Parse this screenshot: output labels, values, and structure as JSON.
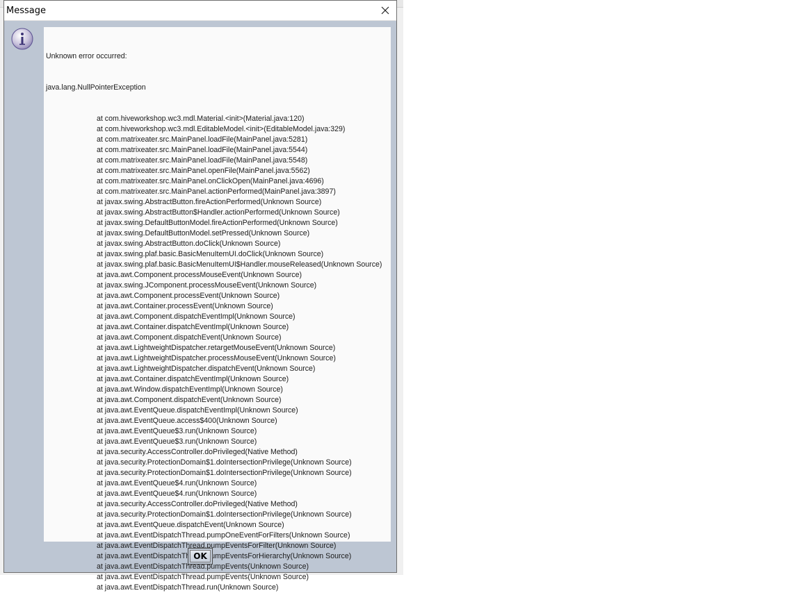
{
  "dialog": {
    "title": "Message",
    "icon": "info-icon",
    "ok_label": "OK"
  },
  "message": {
    "heading": "Unknown error occurred:",
    "exception": "java.lang.NullPointerException",
    "frames": [
      "at com.hiveworkshop.wc3.mdl.Material.<init>(Material.java:120)",
      "at com.hiveworkshop.wc3.mdl.EditableModel.<init>(EditableModel.java:329)",
      "at com.matrixeater.src.MainPanel.loadFile(MainPanel.java:5281)",
      "at com.matrixeater.src.MainPanel.loadFile(MainPanel.java:5544)",
      "at com.matrixeater.src.MainPanel.loadFile(MainPanel.java:5548)",
      "at com.matrixeater.src.MainPanel.openFile(MainPanel.java:5562)",
      "at com.matrixeater.src.MainPanel.onClickOpen(MainPanel.java:4696)",
      "at com.matrixeater.src.MainPanel.actionPerformed(MainPanel.java:3897)",
      "at javax.swing.AbstractButton.fireActionPerformed(Unknown Source)",
      "at javax.swing.AbstractButton$Handler.actionPerformed(Unknown Source)",
      "at javax.swing.DefaultButtonModel.fireActionPerformed(Unknown Source)",
      "at javax.swing.DefaultButtonModel.setPressed(Unknown Source)",
      "at javax.swing.AbstractButton.doClick(Unknown Source)",
      "at javax.swing.plaf.basic.BasicMenuItemUI.doClick(Unknown Source)",
      "at javax.swing.plaf.basic.BasicMenuItemUI$Handler.mouseReleased(Unknown Source)",
      "at java.awt.Component.processMouseEvent(Unknown Source)",
      "at javax.swing.JComponent.processMouseEvent(Unknown Source)",
      "at java.awt.Component.processEvent(Unknown Source)",
      "at java.awt.Container.processEvent(Unknown Source)",
      "at java.awt.Component.dispatchEventImpl(Unknown Source)",
      "at java.awt.Container.dispatchEventImpl(Unknown Source)",
      "at java.awt.Component.dispatchEvent(Unknown Source)",
      "at java.awt.LightweightDispatcher.retargetMouseEvent(Unknown Source)",
      "at java.awt.LightweightDispatcher.processMouseEvent(Unknown Source)",
      "at java.awt.LightweightDispatcher.dispatchEvent(Unknown Source)",
      "at java.awt.Container.dispatchEventImpl(Unknown Source)",
      "at java.awt.Window.dispatchEventImpl(Unknown Source)",
      "at java.awt.Component.dispatchEvent(Unknown Source)",
      "at java.awt.EventQueue.dispatchEventImpl(Unknown Source)",
      "at java.awt.EventQueue.access$400(Unknown Source)",
      "at java.awt.EventQueue$3.run(Unknown Source)",
      "at java.awt.EventQueue$3.run(Unknown Source)",
      "at java.security.AccessController.doPrivileged(Native Method)",
      "at java.security.ProtectionDomain$1.doIntersectionPrivilege(Unknown Source)",
      "at java.security.ProtectionDomain$1.doIntersectionPrivilege(Unknown Source)",
      "at java.awt.EventQueue$4.run(Unknown Source)",
      "at java.awt.EventQueue$4.run(Unknown Source)",
      "at java.security.AccessController.doPrivileged(Native Method)",
      "at java.security.ProtectionDomain$1.doIntersectionPrivilege(Unknown Source)",
      "at java.awt.EventQueue.dispatchEvent(Unknown Source)",
      "at java.awt.EventDispatchThread.pumpOneEventForFilters(Unknown Source)",
      "at java.awt.EventDispatchThread.pumpEventsForFilter(Unknown Source)",
      "at java.awt.EventDispatchThread.pumpEventsForHierarchy(Unknown Source)",
      "at java.awt.EventDispatchThread.pumpEvents(Unknown Source)",
      "at java.awt.EventDispatchThread.pumpEvents(Unknown Source)",
      "at java.awt.EventDispatchThread.run(Unknown Source)"
    ]
  },
  "colors": {
    "dialog_bg": "#bdc6d3",
    "message_bg": "#fafafa",
    "text": "#1a1a1a"
  }
}
